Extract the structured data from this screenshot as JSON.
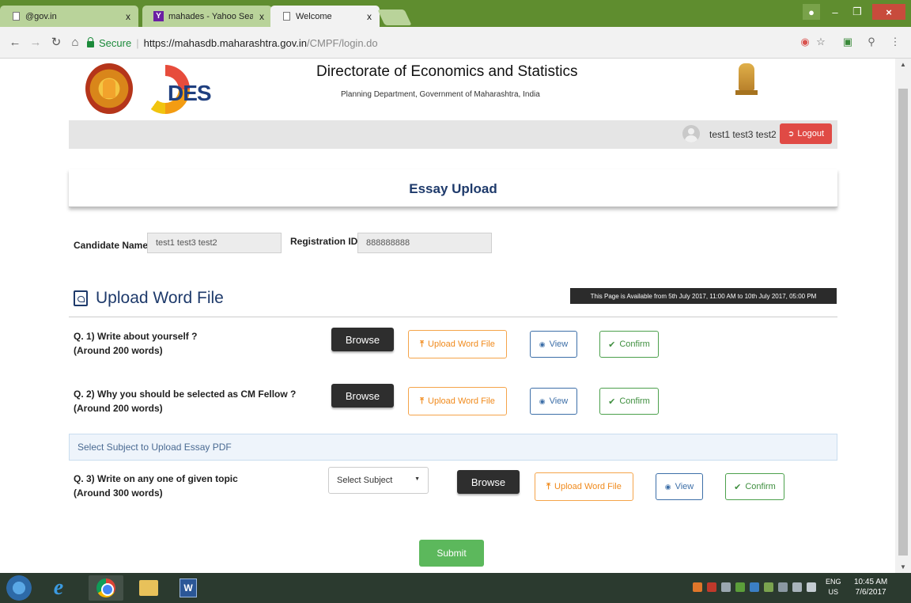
{
  "browser": {
    "tabs": [
      {
        "title": "@gov.in",
        "close": "x"
      },
      {
        "title": "mahades - Yahoo Search",
        "close": "x"
      },
      {
        "title": "Welcome",
        "close": "x"
      }
    ],
    "secure_label": "Secure",
    "url_host": "https://mahasdb.maharashtra.gov.in",
    "url_path": "/CMPF/login.do"
  },
  "header": {
    "logo_text": "DES",
    "title": "Directorate of Economics and Statistics",
    "subtitle": "Planning Department, Government of Maharashtra, India"
  },
  "userbar": {
    "user_name": "test1 test3 test2",
    "logout_label": "Logout"
  },
  "page": {
    "title": "Essay Upload"
  },
  "candidate": {
    "name_label": "Candidate Name",
    "name_value": "test1 test3 test2",
    "reg_label": "Registration ID",
    "reg_value": "888888888"
  },
  "upload": {
    "heading": "Upload Word File",
    "availability": "This Page is Available from 5th July 2017, 11:00 AM to 10th July 2017, 05:00 PM"
  },
  "questions": [
    {
      "line1": "Q. 1) Write about yourself ?",
      "line2": "(Around 200 words)"
    },
    {
      "line1": "Q. 2) Why you should be selected as CM Fellow ?",
      "line2": "(Around 200 words)"
    },
    {
      "line1": "Q. 3) Write on any one of given topic",
      "line2": "(Around 300 words)"
    }
  ],
  "buttons": {
    "browse": "Browse",
    "upload": "Upload Word File",
    "view": "View",
    "confirm": "Confirm",
    "submit": "Submit"
  },
  "subject": {
    "bar_label": "Select Subject to Upload Essay PDF",
    "select_value": "Select Subject"
  },
  "taskbar": {
    "lang_line1": "ENG",
    "lang_line2": "US",
    "time": "10:45 AM",
    "date": "7/6/2017"
  },
  "colors": {
    "titlebar": "#5f8d2f",
    "heading_blue": "#1e3a6b",
    "logout_red": "#e04a45",
    "upload_orange": "#f08a1c",
    "view_blue": "#3d6fa8",
    "confirm_green": "#4ca04c",
    "submit_green": "#5cb85c"
  }
}
